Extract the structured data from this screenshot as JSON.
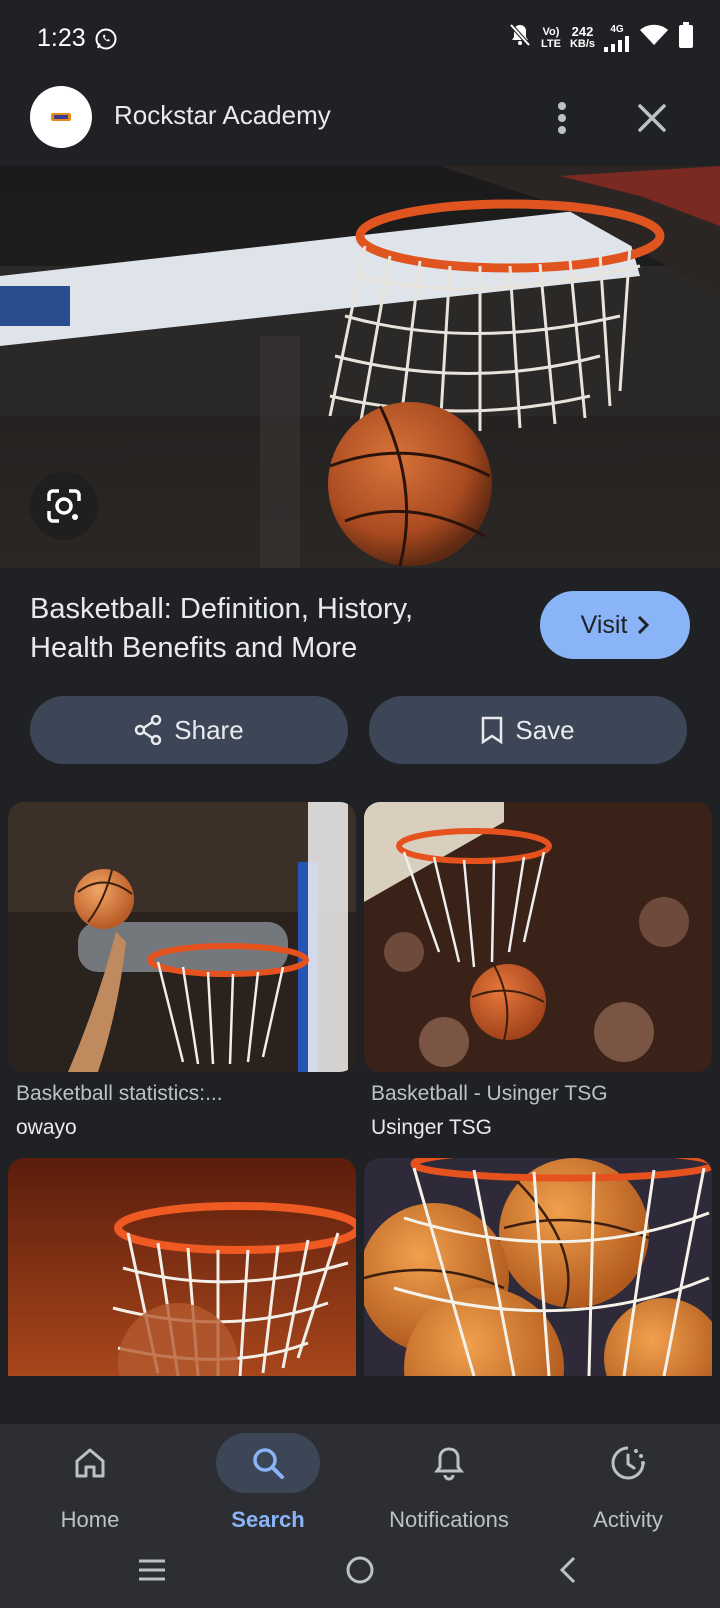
{
  "status_bar": {
    "time": "1:23",
    "volte_top": "Vo)",
    "volte_bottom": "LTE",
    "speed_value": "242",
    "speed_unit": "KB/s",
    "network": "4G"
  },
  "header": {
    "site_name": "Rockstar Academy"
  },
  "result": {
    "title": "Basketball: Definition, History, Health Benefits and More",
    "visit_label": "Visit",
    "share_label": "Share",
    "save_label": "Save"
  },
  "related": [
    {
      "caption": "Basketball statistics:...",
      "source": "owayo"
    },
    {
      "caption": "Basketball - Usinger TSG",
      "source": "Usinger TSG"
    },
    {
      "caption": "",
      "source": ""
    },
    {
      "caption": "",
      "source": ""
    }
  ],
  "nav": {
    "items": [
      {
        "label": "Home",
        "icon": "home-icon"
      },
      {
        "label": "Search",
        "icon": "search-icon",
        "active": true
      },
      {
        "label": "Notifications",
        "icon": "bell-icon"
      },
      {
        "label": "Activity",
        "icon": "activity-icon"
      }
    ]
  },
  "colors": {
    "background": "#202124",
    "accent": "#8ab4f8",
    "button": "#3c4656",
    "nav_bg": "#2c2e33"
  }
}
